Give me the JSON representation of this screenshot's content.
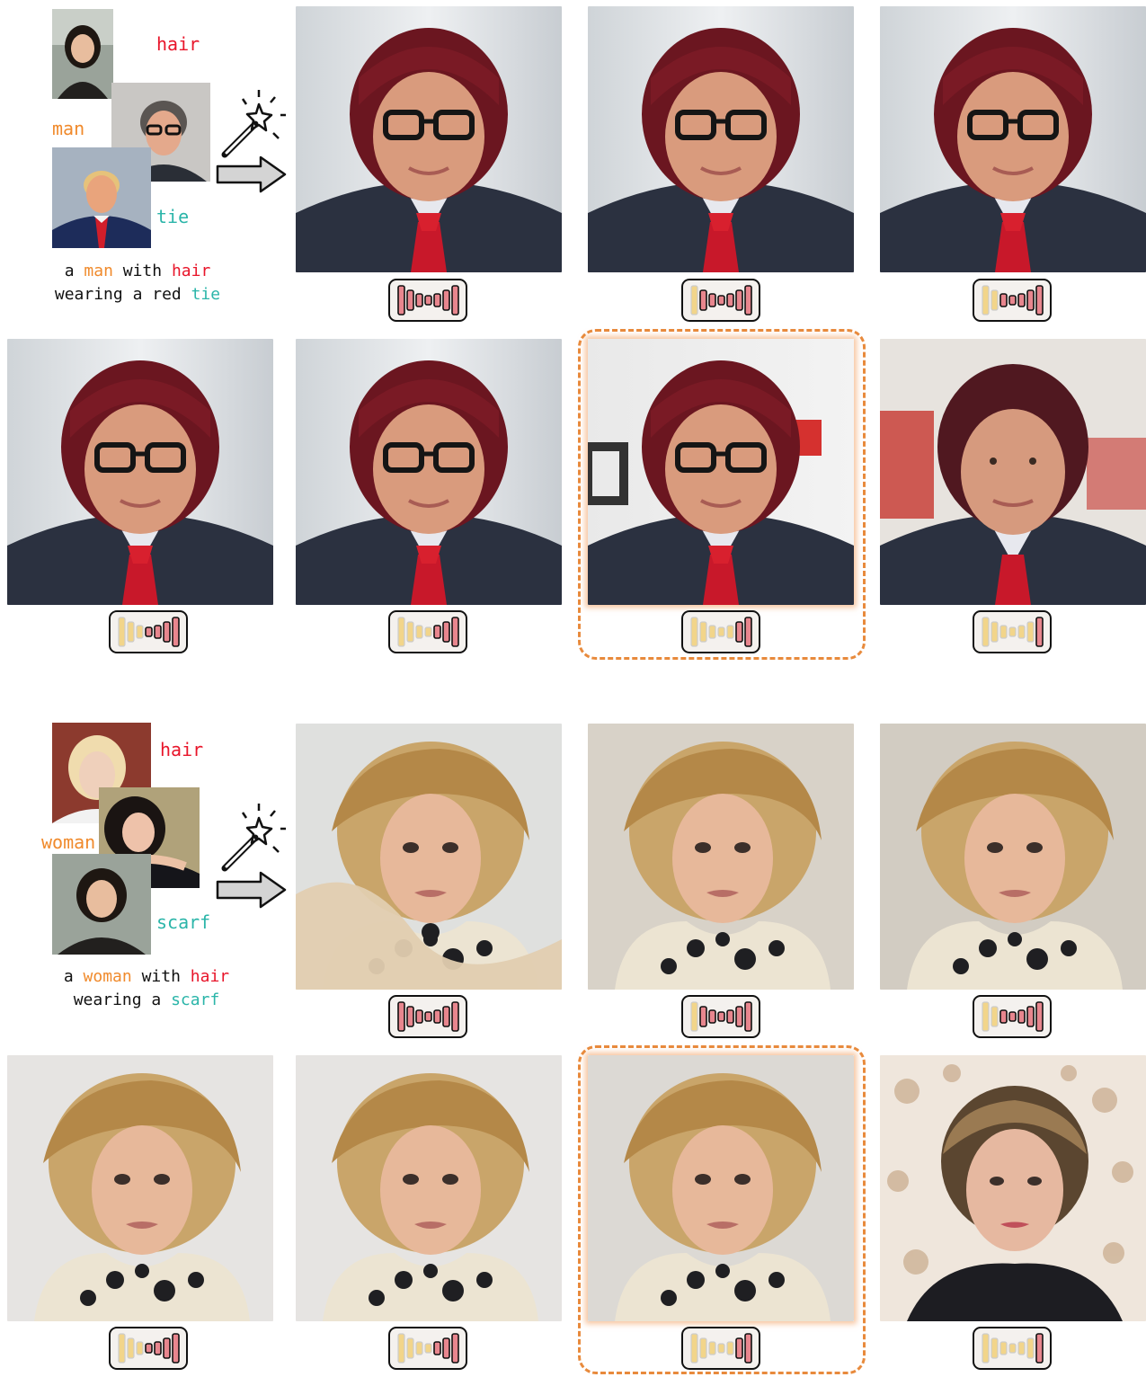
{
  "colors": {
    "red": "#e8152a",
    "orange": "#f08a2c",
    "teal": "#2bb5a9",
    "dashed": "#e88a3c",
    "bar_yellow": "#f2d58a",
    "bar_red": "#e8868e"
  },
  "panel_a": {
    "labels": {
      "hair": "hair",
      "man": "man",
      "tie": "tie"
    },
    "caption": {
      "p1": "a ",
      "subject": "man",
      "p2": " with ",
      "hair": "hair",
      "line2_pre": "wearing a red ",
      "tie": "tie"
    },
    "icons": [
      "wand-icon",
      "arrow-icon"
    ]
  },
  "panel_b": {
    "labels": {
      "hair": "hair",
      "woman": "woman",
      "scarf": "scarf"
    },
    "caption": {
      "p1": "a ",
      "subject": "woman",
      "p2": " with ",
      "hair": "hair",
      "line2_pre": "wearing a ",
      "scarf": "scarf"
    },
    "icons": [
      "wand-icon",
      "arrow-icon"
    ]
  }
}
